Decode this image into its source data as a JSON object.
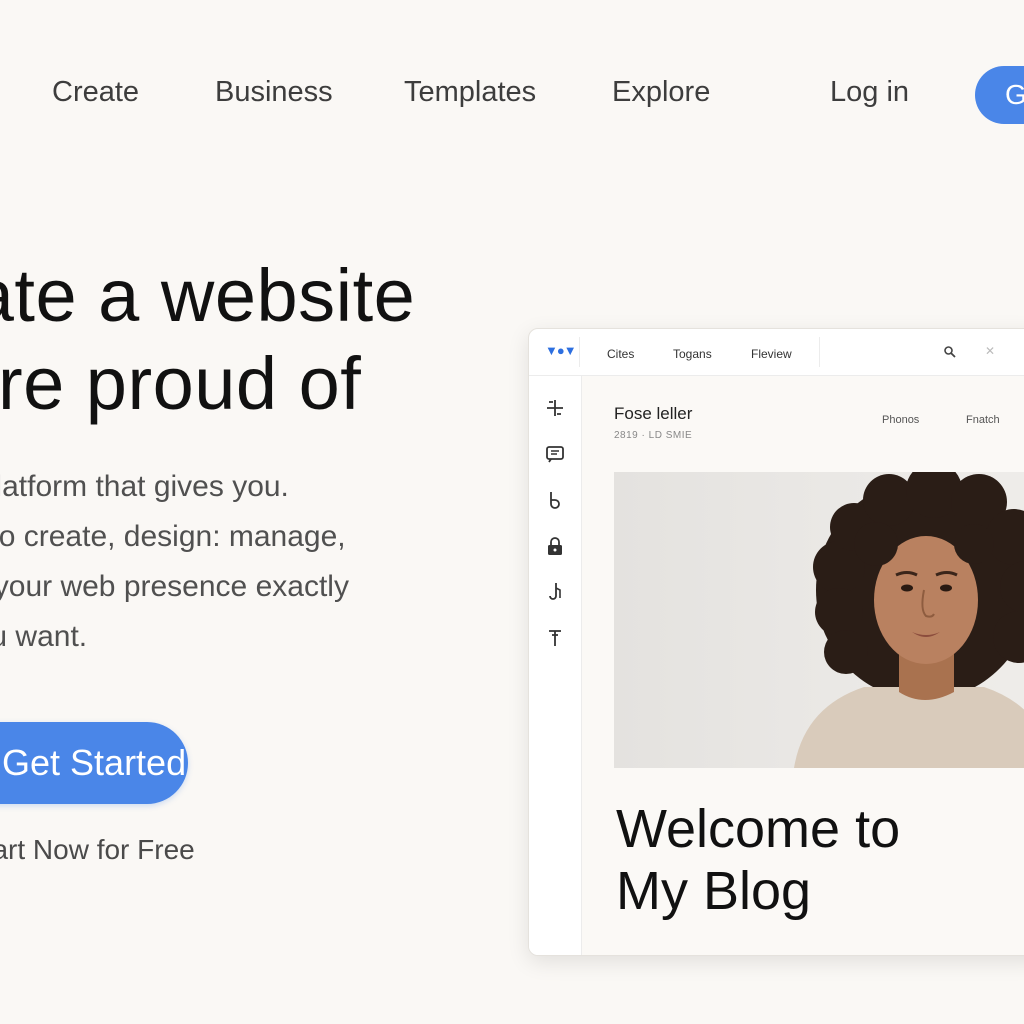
{
  "nav": {
    "items": [
      "Create",
      "Business",
      "Templates",
      "Explore"
    ],
    "login": "Log in",
    "cta": "G"
  },
  "hero": {
    "title_lines": [
      "Create a website",
      "you“re proud of"
    ],
    "description_lines": [
      "ose the platform that gives you.",
      "freedom to create, design: manage,",
      "d desige your web presence exactly",
      "e way you want."
    ],
    "cta_label": "Get Started",
    "cta_sub": "Start Now for Free"
  },
  "editor": {
    "menu": [
      "Cites",
      "Togans",
      "Fleview"
    ],
    "site_name": "Fose leller",
    "site_subtitle": "2819 · LD SMIE",
    "site_links": [
      "Phonos",
      "Fnatch"
    ],
    "blog_title_lines": [
      "Welcome to",
      "My Blog"
    ],
    "tools": [
      "plus-icon",
      "chat-icon",
      "brush-icon",
      "lock-icon",
      "hook-icon",
      "pin-icon"
    ]
  },
  "colors": {
    "background": "#faf8f5",
    "accent": "#4a86e8",
    "text": "#111111"
  }
}
